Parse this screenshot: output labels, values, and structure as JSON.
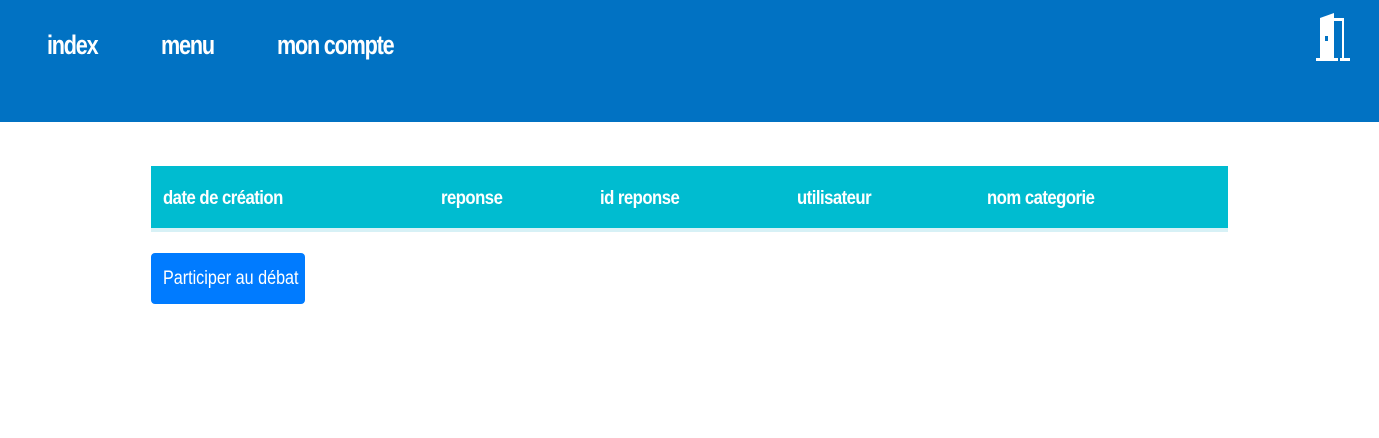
{
  "header": {
    "nav": [
      {
        "label": "index"
      },
      {
        "label": "menu"
      },
      {
        "label": "mon compte"
      }
    ],
    "logout_icon": "door-exit-icon",
    "background_color": "#0172c3"
  },
  "table": {
    "columns": [
      "date de création",
      "reponse",
      "id reponse",
      "utilisateur",
      "nom categorie"
    ],
    "rows": [],
    "header_color": "#00bcd0"
  },
  "actions": {
    "participate_label": "Participer au débat",
    "button_color": "#007bff"
  }
}
